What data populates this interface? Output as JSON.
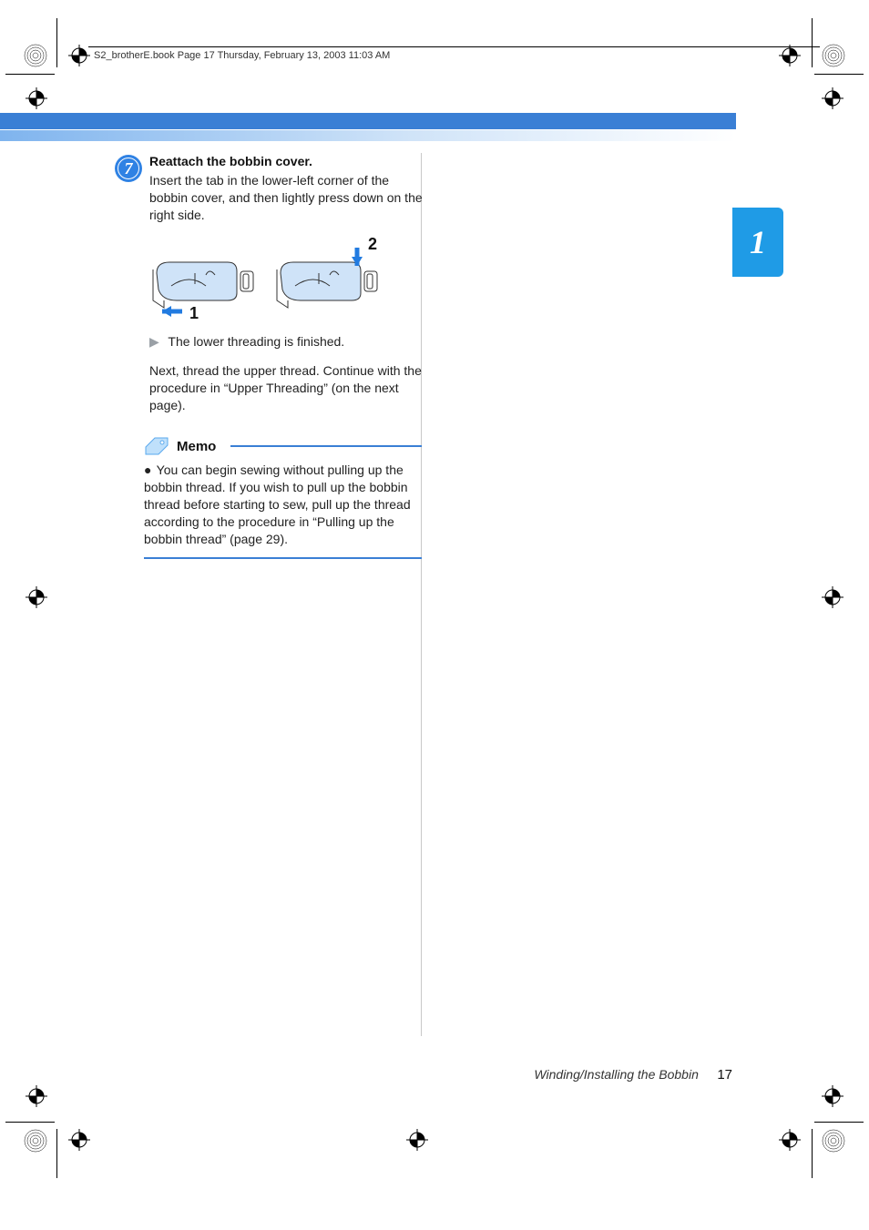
{
  "header": {
    "running_head": "S2_brotherE.book  Page 17  Thursday, February 13, 2003  11:03 AM"
  },
  "chapter": {
    "number": "1"
  },
  "step": {
    "number": "7",
    "title": "Reattach the bobbin cover.",
    "body": "Insert the tab in the lower-left corner of the bobbin cover, and then lightly press down on the right side."
  },
  "illustration": {
    "callout_left": "1",
    "callout_right": "2"
  },
  "result": {
    "marker": "▶",
    "text": "The lower threading is finished."
  },
  "paragraph": "Next, thread the upper thread. Continue with the procedure in “Upper Threading” (on the next page).",
  "memo": {
    "label": "Memo",
    "bullet": "●",
    "text": "You can begin sewing without pulling up the bobbin thread. If you wish to pull up the bobbin thread before starting to sew, pull up the thread according to the procedure in “Pulling up the bobbin thread” (page 29)."
  },
  "footer": {
    "section": "Winding/Installing the Bobbin",
    "page": "17"
  }
}
